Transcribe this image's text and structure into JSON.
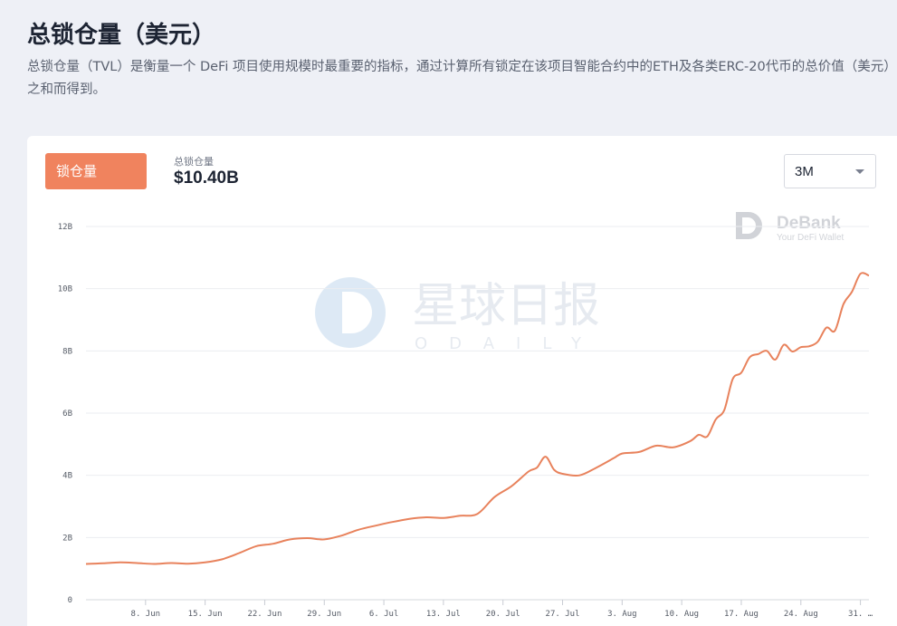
{
  "header": {
    "title": "总锁仓量（美元）",
    "description": "总锁仓量（TVL）是衡量一个 DeFi 项目使用规模时最重要的指标，通过计算所有锁定在该项目智能合约中的ETH及各类ERC-20代币的总价值（美元）之和而得到。"
  },
  "card": {
    "tab_label": "锁仓量",
    "metric_label": "总锁仓量",
    "metric_value": "$10.40B",
    "range_value": "3M"
  },
  "watermarks": {
    "debank_name": "DeBank",
    "debank_tagline": "Your DeFi Wallet",
    "odaily_cn": "星球日报",
    "odaily_en": "ODAILY"
  },
  "colors": {
    "line": "#e8825c",
    "accent": "#f0835e",
    "grid": "#ebedf1"
  },
  "chart_data": {
    "type": "line",
    "title": "",
    "xlabel": "",
    "ylabel": "",
    "ylim": [
      0,
      12
    ],
    "y_ticks": [
      0,
      2,
      4,
      6,
      8,
      10,
      12
    ],
    "y_tick_labels": [
      "0",
      "2B",
      "4B",
      "6B",
      "8B",
      "10B",
      "12B"
    ],
    "unit": "B USD",
    "x_tick_labels": [
      "8. Jun",
      "15. Jun",
      "22. Jun",
      "29. Jun",
      "6. Jul",
      "13. Jul",
      "20. Jul",
      "27. Jul",
      "3. Aug",
      "10. Aug",
      "17. Aug",
      "24. Aug",
      "31. …"
    ],
    "x_ticks": [
      "2020-06-08",
      "2020-06-15",
      "2020-06-22",
      "2020-06-29",
      "2020-07-06",
      "2020-07-13",
      "2020-07-20",
      "2020-07-27",
      "2020-08-03",
      "2020-08-10",
      "2020-08-17",
      "2020-08-24",
      "2020-08-31"
    ],
    "x_range": [
      "2020-06-01",
      "2020-09-01"
    ],
    "grid": true,
    "legend": "none",
    "series": [
      {
        "x": [
          "2020-06-01",
          "2020-06-03",
          "2020-06-05",
          "2020-06-07",
          "2020-06-09",
          "2020-06-11",
          "2020-06-13",
          "2020-06-15",
          "2020-06-17",
          "2020-06-19",
          "2020-06-21",
          "2020-06-23",
          "2020-06-25",
          "2020-06-27",
          "2020-06-29",
          "2020-07-01",
          "2020-07-03",
          "2020-07-05",
          "2020-07-07",
          "2020-07-09",
          "2020-07-11",
          "2020-07-13",
          "2020-07-15",
          "2020-07-17",
          "2020-07-19",
          "2020-07-21",
          "2020-07-23",
          "2020-07-24",
          "2020-07-25",
          "2020-07-26",
          "2020-07-27",
          "2020-07-29",
          "2020-07-31",
          "2020-08-02",
          "2020-08-03",
          "2020-08-05",
          "2020-08-07",
          "2020-08-09",
          "2020-08-11",
          "2020-08-12",
          "2020-08-13",
          "2020-08-14",
          "2020-08-15",
          "2020-08-16",
          "2020-08-17",
          "2020-08-18",
          "2020-08-19",
          "2020-08-20",
          "2020-08-21",
          "2020-08-22",
          "2020-08-23",
          "2020-08-24",
          "2020-08-25",
          "2020-08-26",
          "2020-08-27",
          "2020-08-28",
          "2020-08-29",
          "2020-08-30",
          "2020-08-31",
          "2020-09-01"
        ],
        "values": [
          1.15,
          1.17,
          1.2,
          1.18,
          1.15,
          1.18,
          1.16,
          1.2,
          1.3,
          1.5,
          1.72,
          1.8,
          1.94,
          1.98,
          1.94,
          2.06,
          2.25,
          2.38,
          2.5,
          2.6,
          2.65,
          2.63,
          2.7,
          2.76,
          3.3,
          3.65,
          4.12,
          4.25,
          4.6,
          4.18,
          4.05,
          4.0,
          4.25,
          4.55,
          4.7,
          4.75,
          4.95,
          4.9,
          5.1,
          5.3,
          5.25,
          5.8,
          6.1,
          7.1,
          7.3,
          7.8,
          7.9,
          8.0,
          7.72,
          8.2,
          7.98,
          8.12,
          8.15,
          8.3,
          8.75,
          8.65,
          9.5,
          9.9,
          10.48,
          10.42
        ]
      }
    ]
  }
}
